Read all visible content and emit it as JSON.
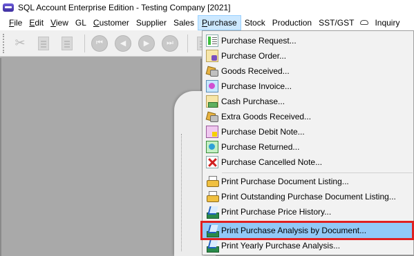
{
  "window": {
    "title": "SQL Account Enterprise Edition - Testing Company [2021]",
    "app_icon": "sql-account-logo-icon"
  },
  "menubar": {
    "items": [
      {
        "label": "File",
        "accel": "F",
        "rest": "ile"
      },
      {
        "label": "Edit",
        "accel": "E",
        "rest": "dit"
      },
      {
        "label": "View",
        "accel": "V",
        "rest": "iew"
      },
      {
        "label": "GL",
        "accel": "",
        "rest": "GL"
      },
      {
        "label": "Customer",
        "accel": "C",
        "rest": "ustomer"
      },
      {
        "label": "Supplier",
        "accel": "",
        "rest": "Supplier"
      },
      {
        "label": "Sales",
        "accel": "",
        "rest": "Sales"
      },
      {
        "label": "Purchase",
        "accel": "P",
        "rest": "urchase"
      },
      {
        "label": "Stock",
        "accel": "",
        "rest": "Stock"
      },
      {
        "label": "Production",
        "accel": "",
        "rest": "Production"
      },
      {
        "label": "SST/GST",
        "accel": "",
        "rest": "SST/GST"
      },
      {
        "label": "Inquiry",
        "accel": "",
        "rest": "Inquiry"
      }
    ],
    "active": "Purchase",
    "cloud_icon": "cloud-icon"
  },
  "toolbar": {
    "buttons": [
      "cut-icon",
      "copy-icon",
      "paste-icon",
      "first-record-icon",
      "previous-record-icon",
      "next-record-icon",
      "last-record-icon",
      "new-document-icon"
    ]
  },
  "purchase_menu": {
    "items": [
      {
        "label": "Purchase Request...",
        "icon": "purchase-request-icon"
      },
      {
        "label": "Purchase Order...",
        "icon": "purchase-order-icon"
      },
      {
        "label": "Goods Received...",
        "icon": "goods-received-icon"
      },
      {
        "label": "Purchase Invoice...",
        "icon": "purchase-invoice-icon"
      },
      {
        "label": "Cash Purchase...",
        "icon": "cash-purchase-icon"
      },
      {
        "label": "Extra Goods Received...",
        "icon": "extra-goods-received-icon"
      },
      {
        "label": "Purchase Debit Note...",
        "icon": "purchase-debit-note-icon"
      },
      {
        "label": "Purchase Returned...",
        "icon": "purchase-returned-icon"
      },
      {
        "label": "Purchase Cancelled Note...",
        "icon": "purchase-cancelled-note-icon"
      },
      {
        "label": "Print Purchase Document Listing...",
        "icon": "printer-icon"
      },
      {
        "label": "Print Outstanding Purchase Document Listing...",
        "icon": "printer-icon"
      },
      {
        "label": "Print Purchase Price History...",
        "icon": "chart-report-icon"
      },
      {
        "label": "Print Purchase Analysis by Document...",
        "icon": "chart-report-icon"
      },
      {
        "label": "Print Yearly Purchase Analysis...",
        "icon": "chart-report-icon"
      }
    ],
    "highlighted": "Print Purchase Analysis by Document...",
    "highlight_color": "#91c9f7",
    "callout_color": "#e02020"
  }
}
